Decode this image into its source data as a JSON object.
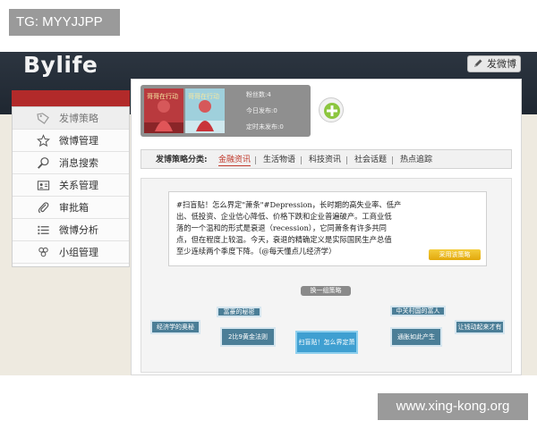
{
  "overlays": {
    "tag": "TG: MYYJJPP",
    "watermark": "www.xing-kong.org"
  },
  "header": {
    "logo": "Bylife",
    "post_button": "发微博"
  },
  "sidebar": {
    "items": [
      {
        "label": "发博策略",
        "icon": "tag-icon",
        "active": true
      },
      {
        "label": "微博管理",
        "icon": "star-icon"
      },
      {
        "label": "消息搜索",
        "icon": "search-icon"
      },
      {
        "label": "关系管理",
        "icon": "contact-card-icon"
      },
      {
        "label": "审批箱",
        "icon": "paperclip-icon"
      },
      {
        "label": "微博分析",
        "icon": "list-icon"
      },
      {
        "label": "小组管理",
        "icon": "group-icon"
      }
    ]
  },
  "accounts": {
    "thumb1_label": "哥哥在行动",
    "thumb2_label": "哥哥在行动",
    "stats": [
      "粉丝数:4",
      "今日发布:0",
      "定时未发布:0"
    ]
  },
  "categories": {
    "label": "发博策略分类:",
    "tabs": [
      "金融资讯",
      "生活物语",
      "科技资讯",
      "社会话题",
      "热点追踪"
    ],
    "active_index": 0
  },
  "strategy": {
    "post_lines": [
      "#扫盲贴！怎么界定\"萧条\"#Depression，长时期的高失业率、低产",
      "出、低投资、企业信心降低、价格下跌和企业普遍破产。工商业低",
      "落的一个温和的形式是衰退（recession），它同萧条有许多共同",
      "点，但在程度上较温。今天，衰退的精确定义是实际国民生产总值",
      "至少连续两个季度下降。（@每天懂点儿经济学）"
    ],
    "adopt_button": "采用该策略",
    "swap_button": "换一组策略",
    "nodes": [
      "经济学的奥秘",
      "富豪的秘密",
      "2比9黄金法则",
      "扫盲贴！怎么界定萧条",
      "中关村国的富人",
      "通胀如此产生",
      "让钱动起来才有价值"
    ]
  },
  "colors": {
    "header_bg": "#1f2731",
    "sidebar_accent": "#b22a2a",
    "active_tab": "#c0392b",
    "adopt_button": "#e8b319",
    "node": "#4b7e97",
    "node_center": "#3f9fd1"
  }
}
